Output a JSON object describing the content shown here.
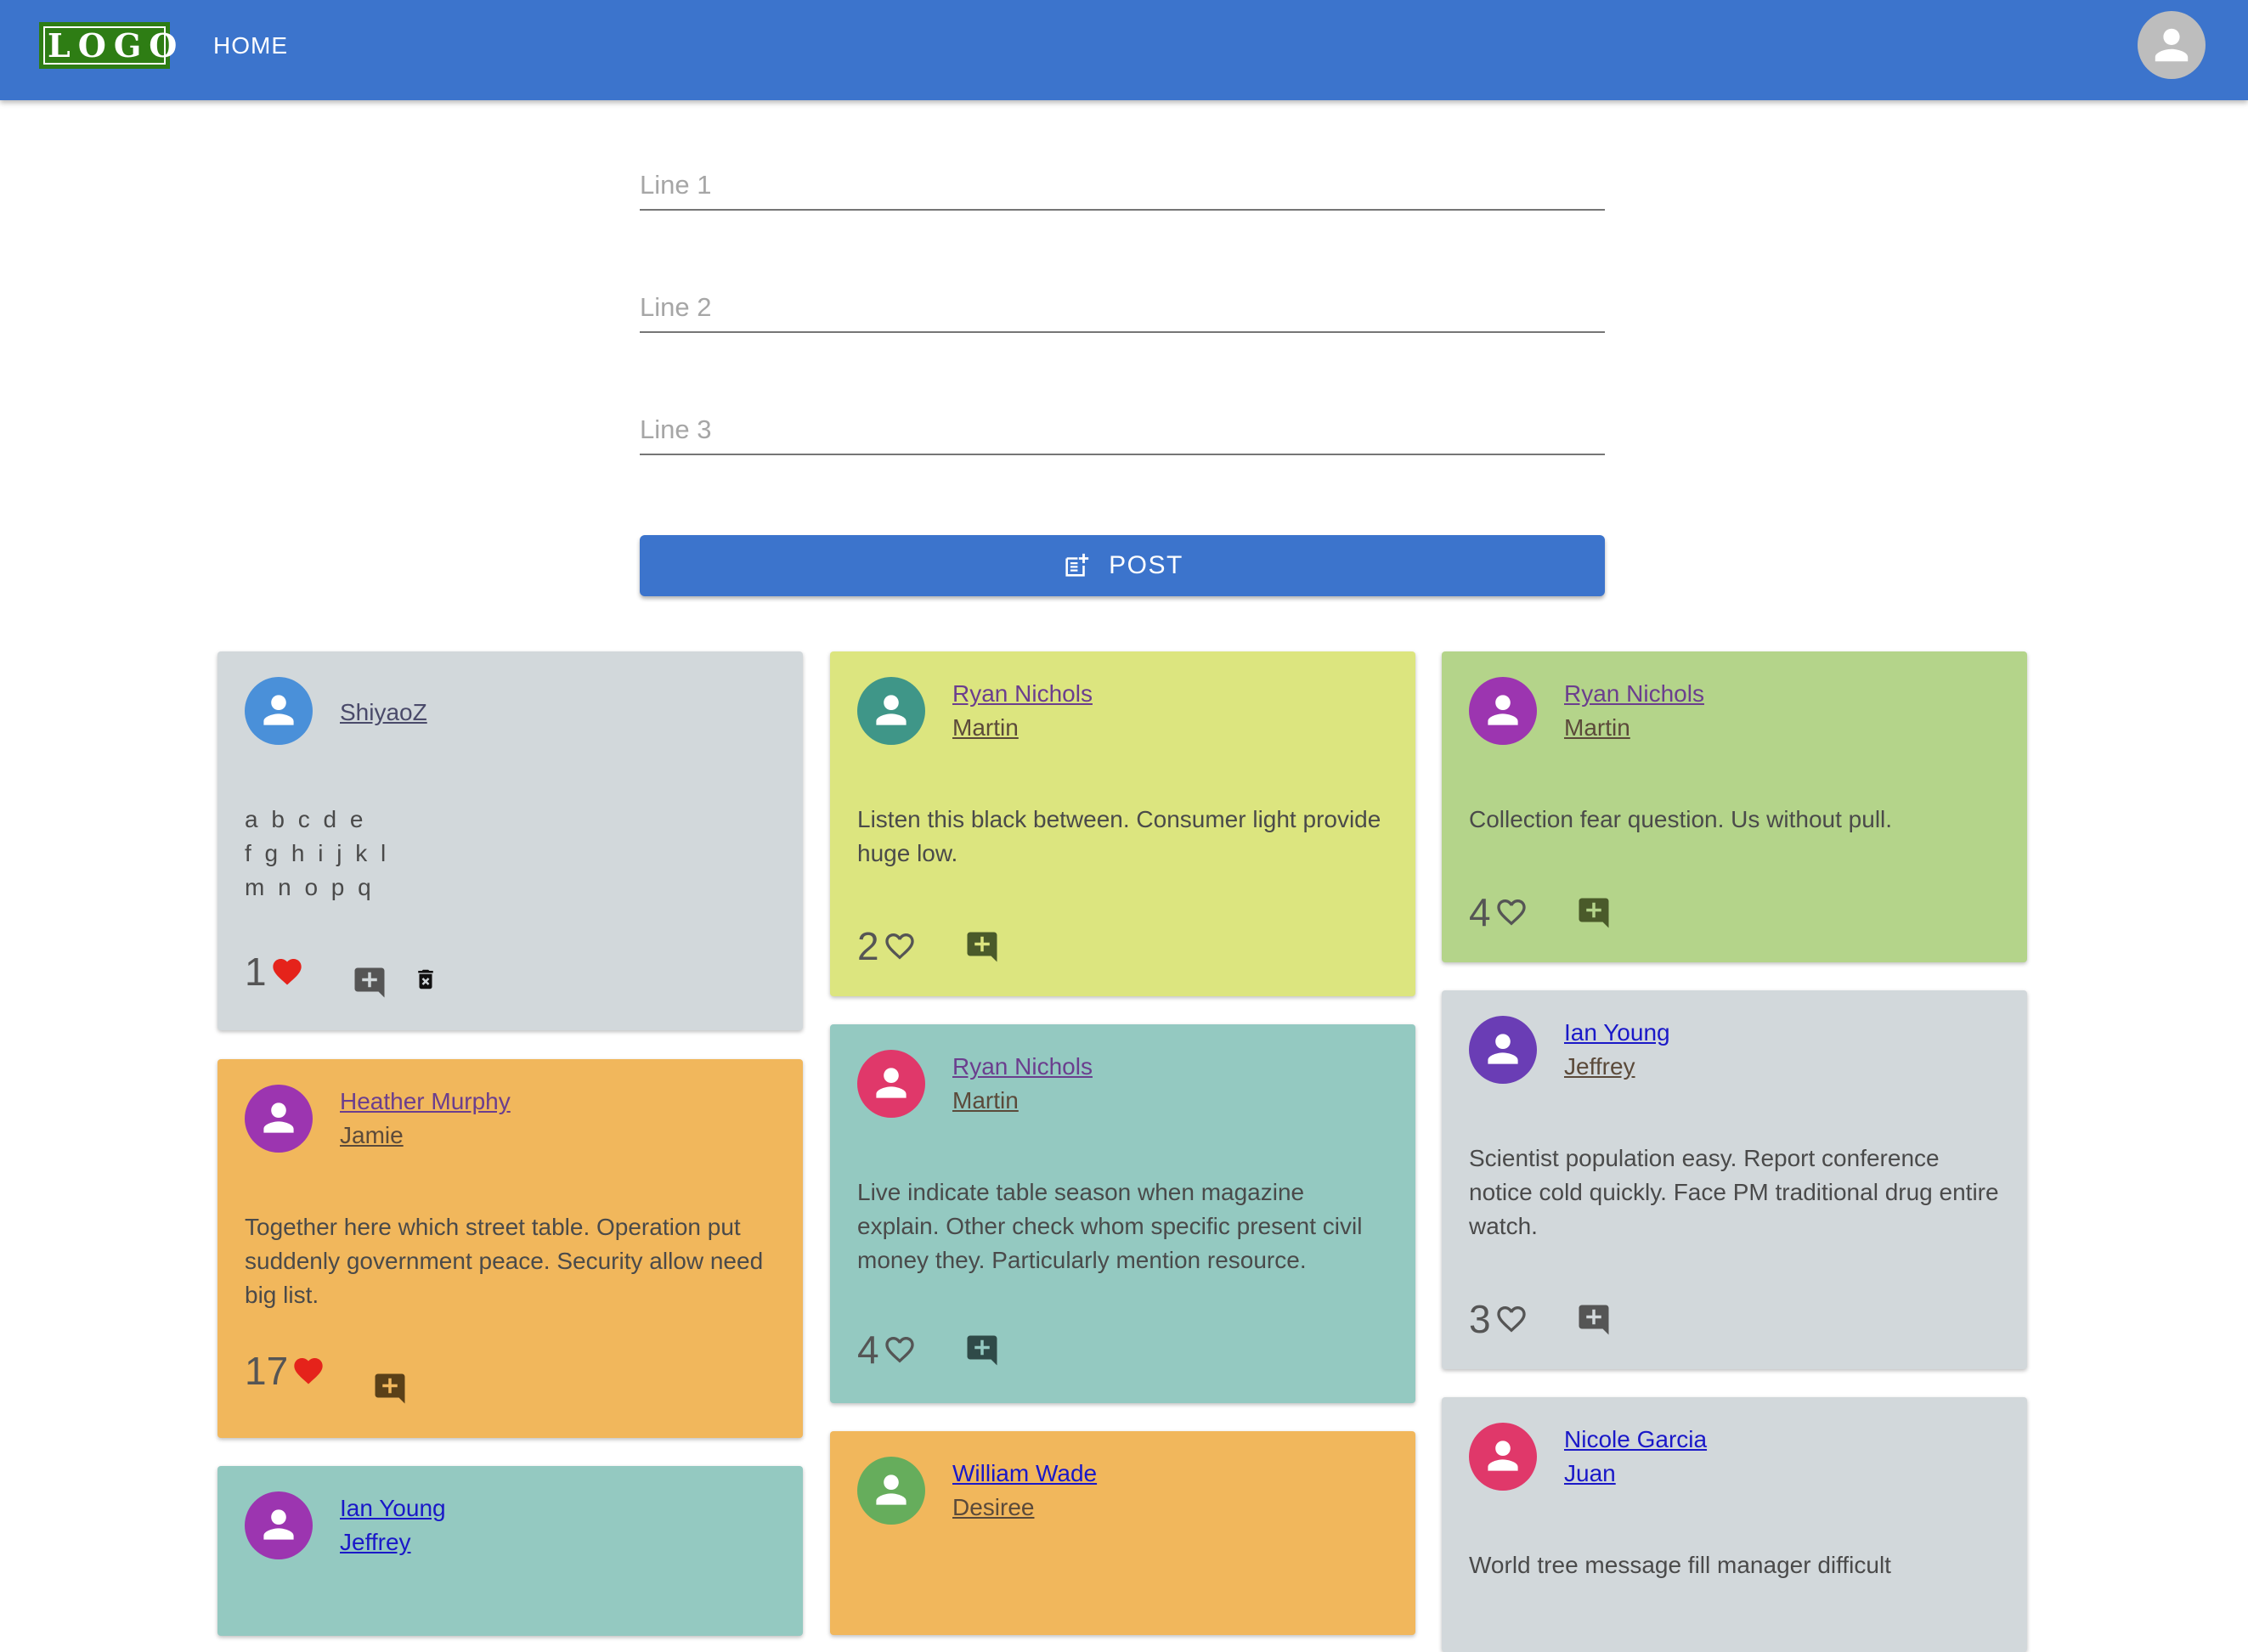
{
  "header": {
    "logo_text": "LOGO",
    "nav_home": "HOME",
    "account_icon": "account-circle-icon",
    "bar_color": "#3c74cc"
  },
  "composer": {
    "line1_placeholder": "Line 1",
    "line2_placeholder": "Line 2",
    "line3_placeholder": "Line 3",
    "line1_value": "",
    "line2_value": "",
    "line3_value": "",
    "post_label": "POST",
    "post_icon": "post-add-icon"
  },
  "cards": [
    {
      "name": "ShiyaoZ",
      "sub": "",
      "lines": [
        "a b c d e",
        "f g h i j k l",
        "m n o p q"
      ],
      "likes": "1",
      "liked": true,
      "deletable": true,
      "bg": "#d2d8db",
      "avatar_color": "#4a90d9"
    },
    {
      "name": "Heather Murphy",
      "sub": "Jamie",
      "text": "Together here which street table. Operation put suddenly government peace. Security allow need big list.",
      "likes": "17",
      "liked": true,
      "bg": "#f1b75c",
      "avatar_color": "#9c35b0"
    },
    {
      "name": "Ian Young",
      "sub": "Jeffrey",
      "bg": "#94c9c1",
      "avatar_color": "#9c35b0"
    },
    {
      "name": "Ryan Nichols",
      "sub": "Martin",
      "text": "Listen this black between. Consumer light provide huge low.",
      "likes": "2",
      "liked": false,
      "bg": "#dce57f",
      "avatar_color": "#3f9688"
    },
    {
      "name": "Ryan Nichols",
      "sub": "Martin",
      "text": "Live indicate table season when magazine explain. Other check whom specific present civil money they. Particularly mention resource.",
      "likes": "4",
      "liked": false,
      "bg": "#94c9c1",
      "avatar_color": "#e0386a"
    },
    {
      "name": "William Wade",
      "sub": "Desiree",
      "bg": "#f1b75c",
      "avatar_color": "#66ad5c"
    },
    {
      "name": "Ryan Nichols",
      "sub": "Martin",
      "text": "Collection fear question. Us without pull.",
      "likes": "4",
      "liked": false,
      "bg": "#b4d48a",
      "avatar_color": "#9c35b0"
    },
    {
      "name": "Ian Young",
      "sub": "Jeffrey",
      "text": "Scientist population easy. Report conference notice cold quickly. Face PM traditional drug entire watch.",
      "likes": "3",
      "liked": false,
      "bg": "#d2d8db",
      "avatar_color": "#6a3db5"
    },
    {
      "name": "Nicole Garcia",
      "sub": "Juan",
      "text": "World tree message fill manager difficult",
      "bg": "#d2d8db",
      "avatar_color": "#e0386a"
    }
  ],
  "icons": {
    "like_filled": "heart-filled-icon",
    "like_outline": "heart-outline-icon",
    "comment": "add-comment-icon",
    "delete": "delete-forever-icon",
    "avatar": "person-icon"
  },
  "colors": {
    "heart_filled": "#e5231b",
    "link_visited": "#6b3e8e",
    "link_unvisited": "#1a18c8"
  }
}
